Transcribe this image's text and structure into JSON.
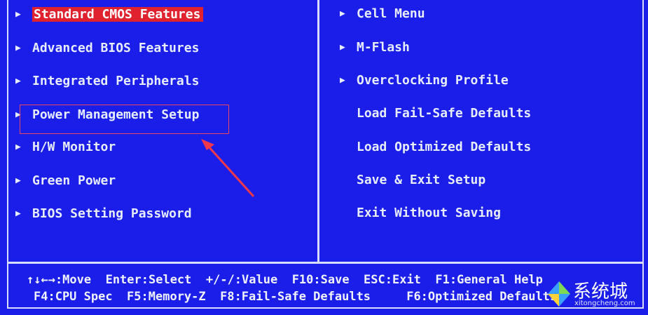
{
  "left_menu": [
    {
      "label": "Standard CMOS Features",
      "arrow": "▶"
    },
    {
      "label": "Advanced BIOS Features",
      "arrow": "▶"
    },
    {
      "label": "Integrated Peripherals",
      "arrow": "▶"
    },
    {
      "label": "Power Management Setup",
      "arrow": "▶"
    },
    {
      "label": "H/W Monitor",
      "arrow": "▶"
    },
    {
      "label": "Green Power",
      "arrow": "▶"
    },
    {
      "label": "BIOS Setting Password",
      "arrow": "▶"
    }
  ],
  "right_menu": [
    {
      "label": "Cell Menu",
      "arrow": "▶"
    },
    {
      "label": "M-Flash",
      "arrow": "▶"
    },
    {
      "label": "Overclocking Profile",
      "arrow": "▶"
    },
    {
      "label": "Load Fail-Safe Defaults"
    },
    {
      "label": "Load Optimized Defaults"
    },
    {
      "label": "Save & Exit Setup"
    },
    {
      "label": "Exit Without Saving"
    }
  ],
  "keys": {
    "line1": "↑↓←→:Move  Enter:Select  +/-/:Value  F10:Save  ESC:Exit  F1:General Help",
    "line2": "F4:CPU Spec  F5:Memory-Z  F8:Fail-Safe Defaults     F6:Optimized Defaults"
  },
  "watermark": {
    "text": "系统城",
    "url": "xitongcheng.com"
  },
  "colors": {
    "background": "#1a1ee8",
    "selected": "#e0212e",
    "annotation": "#e8485a"
  }
}
